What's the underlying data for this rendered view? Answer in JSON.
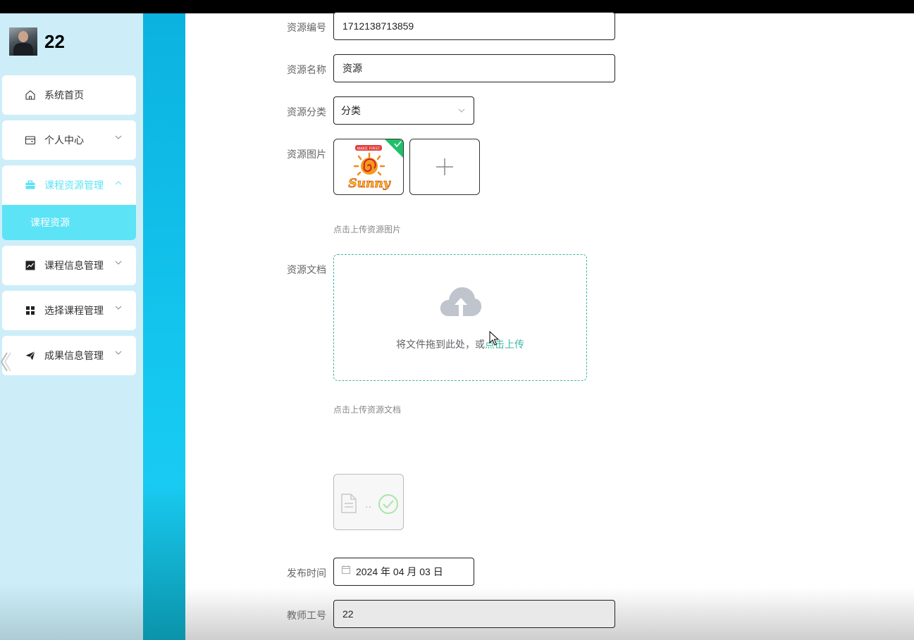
{
  "user": {
    "name": "22"
  },
  "sidebar": {
    "items": [
      {
        "label": "系统首页",
        "icon": "home-icon"
      },
      {
        "label": "个人中心",
        "icon": "wallet-icon"
      },
      {
        "label": "课程资源管理",
        "icon": "briefcase-icon",
        "active": true,
        "sub": [
          "课程资源"
        ]
      },
      {
        "label": "课程信息管理",
        "icon": "chart-icon"
      },
      {
        "label": "选择课程管理",
        "icon": "grid-icon"
      },
      {
        "label": "成果信息管理",
        "icon": "send-icon"
      }
    ]
  },
  "form": {
    "code_label": "资源编号",
    "code_value": "1712138713859",
    "name_label": "资源名称",
    "name_value": "资源",
    "category_label": "资源分类",
    "category_value": "分类",
    "image_label": "资源图片",
    "image_hint": "点击上传资源图片",
    "image_logo_text": "Sunny",
    "image_badge_text": "MAKE FIRST",
    "doc_label": "资源文档",
    "doc_drop_text": "将文件拖到此处，或",
    "doc_drop_link": "点击上传",
    "doc_hint": "点击上传资源文档",
    "doc_file_text": "..",
    "date_label": "发布时间",
    "date_value": "2024 年 04 月 03 日",
    "teacher_label": "教师工号",
    "teacher_value": "22"
  },
  "colors": {
    "accent": "#5ce3f6",
    "upload_link": "#3cb9a6",
    "stripe": "#15c8f0",
    "sidebar_bg": "#cdeef8"
  }
}
